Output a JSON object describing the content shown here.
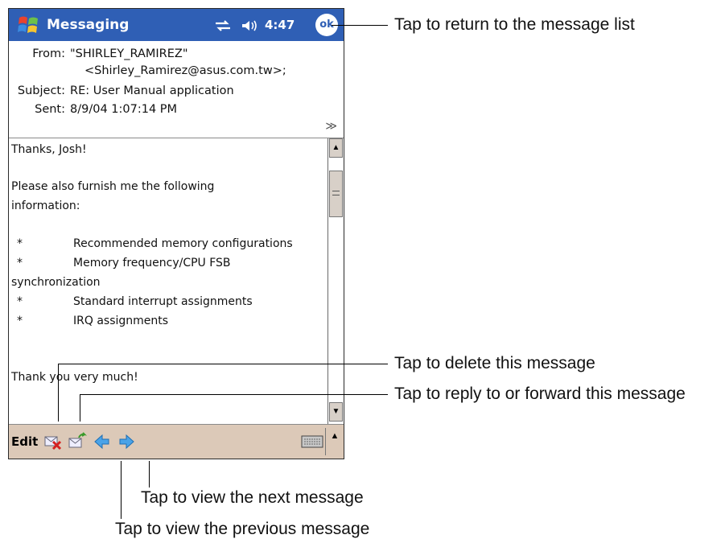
{
  "titlebar": {
    "title": "Messaging",
    "clock": "4:47",
    "ok_label": "ok"
  },
  "header": {
    "from_label": "From:",
    "from_name": "\"SHIRLEY_RAMIREZ\"",
    "from_email": "<Shirley_Ramirez@asus.com.tw>;",
    "subject_label": "Subject:",
    "subject": "RE: User Manual application",
    "sent_label": "Sent:",
    "sent": "8/9/04 1:07:14 PM"
  },
  "body": {
    "greeting": "Thanks, Josh!",
    "line1": "Please also furnish me the following",
    "line2": "information:",
    "bullet_char": "*",
    "item1": "Recommended memory configurations",
    "item2": "Memory frequency/CPU FSB",
    "item2_cont": "synchronization",
    "item3": "Standard interrupt assignments",
    "item4": "IRQ assignments",
    "closing": "Thank you very much!"
  },
  "toolbar": {
    "edit_label": "Edit"
  },
  "callouts": {
    "ok": "Tap to return to the message list",
    "delete": "Tap to delete this message",
    "reply": "Tap to reply to or forward this message",
    "next": "Tap to view the next message",
    "previous": "Tap to view the previous message"
  },
  "icons": {
    "windows": "windows-logo-icon",
    "sync": "sync-icon",
    "volume": "volume-icon",
    "delete": "delete-message-icon",
    "reply": "reply-forward-icon",
    "previous": "previous-message-icon",
    "next": "next-message-icon",
    "keyboard": "keyboard-icon"
  },
  "colors": {
    "titlebar": "#2f5fb5",
    "toolbar": "#dcc9b8"
  }
}
